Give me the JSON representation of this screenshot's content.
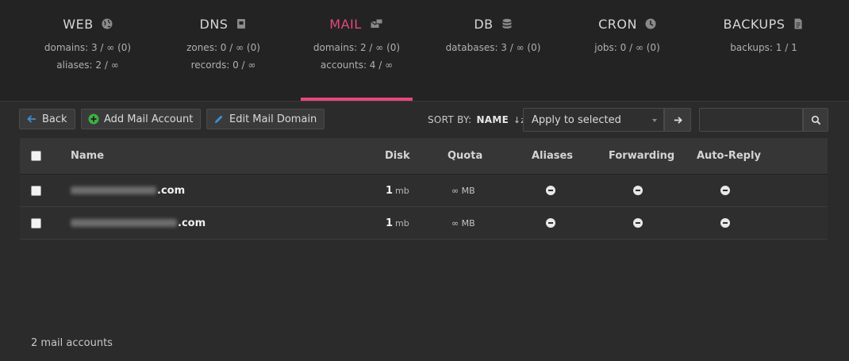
{
  "nav": [
    {
      "label": "WEB",
      "icon": "globe-icon",
      "stats": [
        "domains: 3 / ∞ (0)",
        "aliases: 2 / ∞"
      ],
      "active": false
    },
    {
      "label": "DNS",
      "icon": "book-icon",
      "stats": [
        "zones: 0 / ∞ (0)",
        "records: 0 / ∞"
      ],
      "active": false
    },
    {
      "label": "MAIL",
      "icon": "mail-icon",
      "stats": [
        "domains: 2 / ∞ (0)",
        "accounts: 4 / ∞"
      ],
      "active": true
    },
    {
      "label": "DB",
      "icon": "database-icon",
      "stats": [
        "databases: 3 / ∞ (0)"
      ],
      "active": false
    },
    {
      "label": "CRON",
      "icon": "clock-icon",
      "stats": [
        "jobs: 0 / ∞ (0)"
      ],
      "active": false
    },
    {
      "label": "BACKUPS",
      "icon": "file-icon",
      "stats": [
        "backups: 1 / 1"
      ],
      "active": false
    }
  ],
  "toolbar": {
    "back_label": "Back",
    "add_label": "Add Mail Account",
    "edit_label": "Edit Mail Domain",
    "sort_by_label": "SORT BY:",
    "sort_field": "NAME",
    "apply_selected": "Apply to selected",
    "search_value": ""
  },
  "table": {
    "headers": {
      "name": "Name",
      "disk": "Disk",
      "quota": "Quota",
      "aliases": "Aliases",
      "forwarding": "Forwarding",
      "autoreply": "Auto-Reply"
    },
    "rows": [
      {
        "email_suffix": ".com",
        "disk_value": "1",
        "disk_unit": "mb",
        "quota": "∞ MB"
      },
      {
        "email_suffix": ".com",
        "disk_value": "1",
        "disk_unit": "mb",
        "quota": "∞ MB"
      }
    ]
  },
  "footer": {
    "count_label": "2 mail accounts"
  },
  "colors": {
    "accent": "#e6487c",
    "add_icon": "#3cb043",
    "edit_icon": "#3d8fd6",
    "back_icon": "#3d8fd6"
  }
}
